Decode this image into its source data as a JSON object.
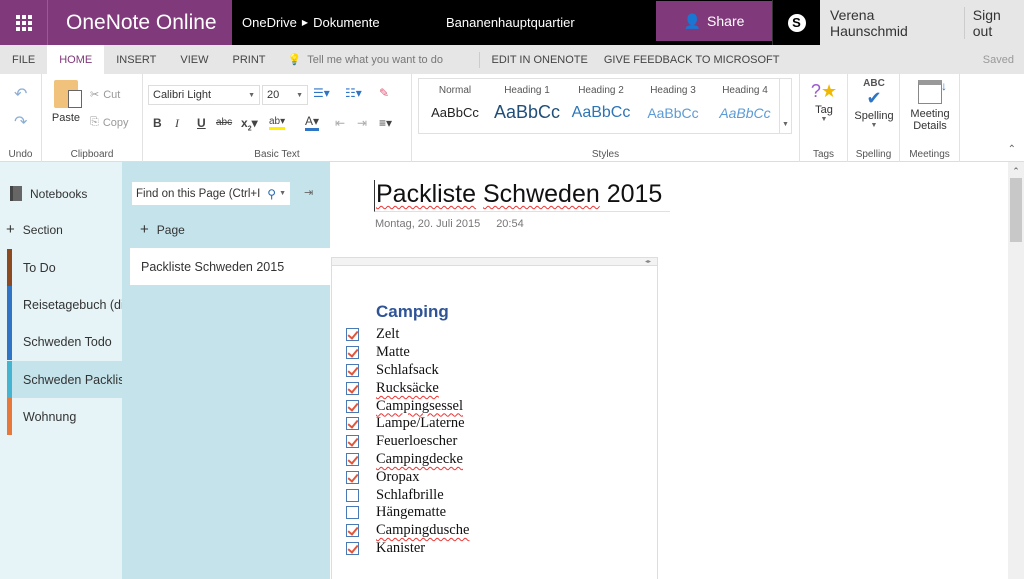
{
  "app": {
    "name": "OneNote Online"
  },
  "breadcrumb": {
    "part1": "OneDrive",
    "part2": "Dokumente"
  },
  "document": {
    "title": "Bananenhauptquartier"
  },
  "header": {
    "share_label": "Share",
    "user_name": "Verena Haunschmid",
    "sign_out": "Sign out"
  },
  "tabs": [
    {
      "label": "FILE"
    },
    {
      "label": "HOME",
      "active": true
    },
    {
      "label": "INSERT"
    },
    {
      "label": "VIEW"
    },
    {
      "label": "PRINT"
    }
  ],
  "tellme": {
    "placeholder": "Tell me what you want to do"
  },
  "extra_tabs": {
    "edit": "EDIT IN ONENOTE",
    "feedback": "GIVE FEEDBACK TO MICROSOFT"
  },
  "status": {
    "saved": "Saved"
  },
  "ribbon": {
    "undo_group": "Undo",
    "clipboard": {
      "label": "Clipboard",
      "paste": "Paste",
      "cut": "Cut",
      "copy": "Copy"
    },
    "basic_text": {
      "label": "Basic Text",
      "font": "Calibri Light",
      "size": "20"
    },
    "styles": {
      "label": "Styles",
      "items": [
        {
          "name": "Normal",
          "sample": "AaBbCc",
          "color": "#222222"
        },
        {
          "name": "Heading 1",
          "sample": "AaBbCc",
          "color": "#1f4e79"
        },
        {
          "name": "Heading 2",
          "sample": "AaBbCc",
          "color": "#2e75b6"
        },
        {
          "name": "Heading 3",
          "sample": "AaBbCc",
          "color": "#5b9bd5"
        },
        {
          "name": "Heading 4",
          "sample": "AaBbCc",
          "color": "#5b9bd5"
        }
      ]
    },
    "tags": {
      "label": "Tags",
      "button": "Tag"
    },
    "spelling": {
      "label": "Spelling",
      "button": "Spelling",
      "abc": "ABC"
    },
    "meetings": {
      "label": "Meetings",
      "button_line1": "Meeting",
      "button_line2": "Details"
    }
  },
  "sections_pane": {
    "notebooks": "Notebooks",
    "add_section": "Section",
    "sections": [
      {
        "name": "To Do",
        "color": "#8b4a1f"
      },
      {
        "name": "Reisetagebuch (di",
        "color": "#2e75c6"
      },
      {
        "name": "Schweden Todo",
        "color": "#2e75c6"
      },
      {
        "name": "Schweden Packlist",
        "color": "#44b4d0",
        "active": true
      },
      {
        "name": "Wohnung",
        "color": "#e8773a"
      }
    ]
  },
  "pages_pane": {
    "find_placeholder": "Find on this Page (Ctrl+I",
    "add_page": "Page",
    "pages": [
      {
        "name": "Packliste Schweden 2015"
      }
    ]
  },
  "page": {
    "title": "Packliste Schweden 2015",
    "date": "Montag, 20. Juli 2015",
    "time": "20:54",
    "heading": "Camping",
    "items": [
      {
        "text": "Zelt",
        "checked": true
      },
      {
        "text": "Matte",
        "checked": true
      },
      {
        "text": "Schlafsack",
        "checked": true
      },
      {
        "text": "Rucksäcke",
        "checked": true,
        "misspelled": true
      },
      {
        "text": "Campingsessel",
        "checked": true,
        "misspelled": true
      },
      {
        "text": "Lampe/Laterne",
        "checked": true
      },
      {
        "text": "Feuerloescher",
        "checked": true
      },
      {
        "text": "Campingdecke",
        "checked": true,
        "misspelled": true
      },
      {
        "text": "Oropax",
        "checked": true
      },
      {
        "text": "Schlafbrille",
        "checked": false
      },
      {
        "text": "Hängematte",
        "checked": false
      },
      {
        "text": "Campingdusche",
        "checked": true,
        "misspelled": true
      },
      {
        "text": "Kanister",
        "checked": true
      }
    ]
  }
}
